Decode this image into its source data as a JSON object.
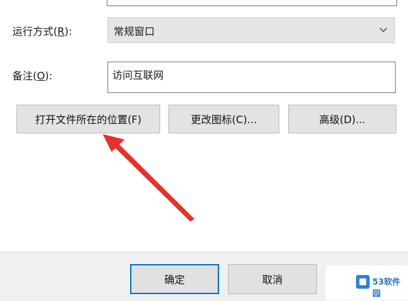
{
  "properties": {
    "run_mode": {
      "label_prefix": "运行方式(",
      "label_key": "R",
      "label_suffix": "):",
      "value": "常规窗口"
    },
    "comment": {
      "label_prefix": "备注(",
      "label_key": "O",
      "label_suffix": "):",
      "value": "访问互联网"
    }
  },
  "buttons": {
    "open_location": "打开文件所在的位置(F)",
    "change_icon": "更改图标(C)...",
    "advanced": "高级(D)..."
  },
  "footer": {
    "ok": "确定",
    "cancel": "取消"
  },
  "watermark": {
    "text": "53软件园"
  },
  "colors": {
    "arrow": "#e8302a",
    "focus_border": "#0078d7"
  }
}
